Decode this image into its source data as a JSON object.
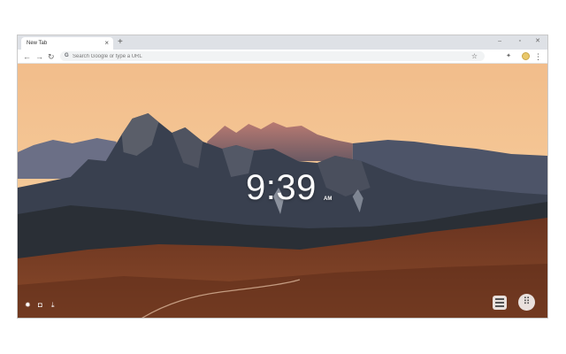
{
  "tab": {
    "title": "New Tab",
    "close_glyph": "×"
  },
  "tabstrip": {
    "new_tab_glyph": "+"
  },
  "window_controls": {
    "minimize": "–",
    "maximize": "▫",
    "close": "✕"
  },
  "toolbar": {
    "back_glyph": "←",
    "forward_glyph": "→",
    "reload_glyph": "↻",
    "omnibox_placeholder": "Search Google or type a URL",
    "omnibox_value": "",
    "google_glyph": "G",
    "star_glyph": "☆",
    "extension_glyph": "✦",
    "menu_glyph": "⋮"
  },
  "clock": {
    "time": "9:39",
    "period": "AM"
  },
  "bottom_bar": {
    "settings_glyph": "✹",
    "camera_glyph": "◘",
    "download_glyph": "⤓",
    "apps_glyph": "⠿"
  },
  "colors": {
    "sky_top": "#f3c391",
    "sky_bottom": "#f6d0a0",
    "mountains": "#3a4456",
    "meadow": "#7a3a1e"
  },
  "icons": {
    "back": "back-arrow-icon",
    "forward": "forward-arrow-icon",
    "reload": "reload-icon",
    "star": "bookmark-star-icon",
    "settings": "settings-icon",
    "camera": "camera-icon",
    "download": "download-icon",
    "list": "list-icon",
    "apps": "apps-grid-icon"
  }
}
